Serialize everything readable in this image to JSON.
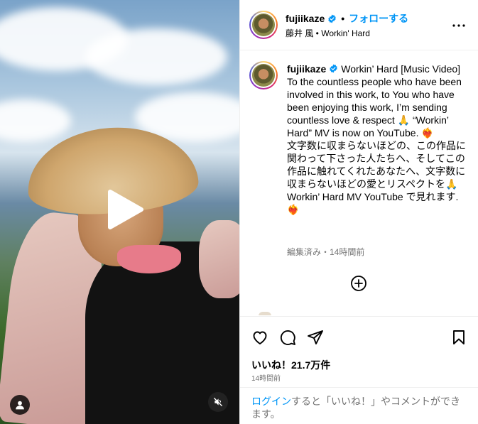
{
  "post": {
    "username": "fujiikaze",
    "verified": true,
    "follow_label": "フォローする",
    "subtitle": "藤井 風 • Workin' Hard"
  },
  "caption": {
    "username": "fujiikaze",
    "text": "Workin’ Hard [Music Video]\nTo the countless people who have been involved in this work, to You who have been enjoying this work, I’m sending countless love & respect 🙏 “Workin’ Hard” MV is now on YouTube. ❤️‍🔥\n文字数に収まらないほどの、この作品に関わって下さった人たちへ、そしてこの作品に触れてくれたあなたへ、文字数に収まらないほどの愛とリスペクトを🙏 Workin’ Hard MV YouTube で見れます. ❤️‍🔥",
    "meta": "編集済み・14時間前"
  },
  "stats": {
    "likes": "いいね！21.7万件",
    "time": "14時間前"
  },
  "login_prompt": {
    "link": "ログイン",
    "rest": "すると「いいね！」やコメントができます。"
  },
  "icons": {
    "more": "more-options-icon",
    "heart": "heart-icon",
    "comment": "comment-icon",
    "share": "share-icon",
    "save": "bookmark-icon",
    "add": "add-comment-icon",
    "play": "play-icon",
    "mute": "muted-speaker-icon",
    "tag": "user-tag-icon",
    "verified": "verified-badge-icon"
  },
  "colors": {
    "accent": "#0095f6",
    "verified": "#0095f6",
    "muted_text": "#737373",
    "divider": "#efefef"
  }
}
